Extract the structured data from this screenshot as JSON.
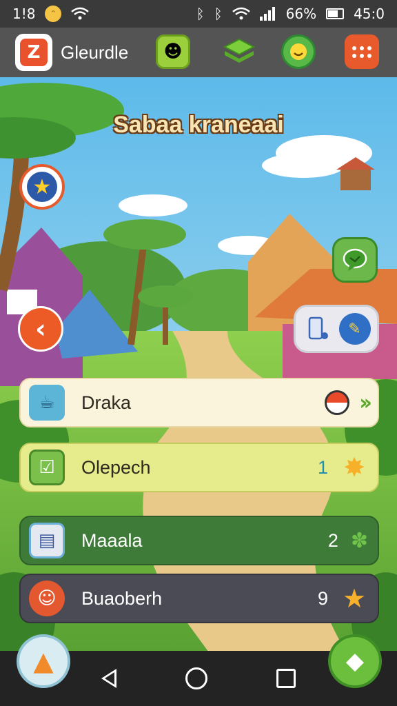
{
  "status_bar": {
    "time_left": "1!8",
    "battery": "66%",
    "time_right": "45:0"
  },
  "app_bar": {
    "title": "Gleurdle",
    "icons": [
      "star-face-icon",
      "stack-icon",
      "smile-bubble-icon",
      "menu-grid-icon"
    ]
  },
  "banner": {
    "title": "Sabaa kraneaai"
  },
  "list": [
    {
      "label": "Draka",
      "count": "",
      "icon": "mug-icon",
      "tail": "ball-and-chevron"
    },
    {
      "label": "Olepech",
      "count": "1",
      "icon": "checklist-icon",
      "tail": "star"
    },
    {
      "label": "Maaala",
      "count": "2",
      "icon": "document-icon",
      "tail": "leaf"
    },
    {
      "label": "Buaoberh",
      "count": "9",
      "icon": "fox-face-icon",
      "tail": "star"
    }
  ],
  "colors": {
    "accent_orange": "#e8592b",
    "accent_green": "#6cb84a",
    "status_bar": "#3a3a3a",
    "app_bar": "#545454"
  }
}
